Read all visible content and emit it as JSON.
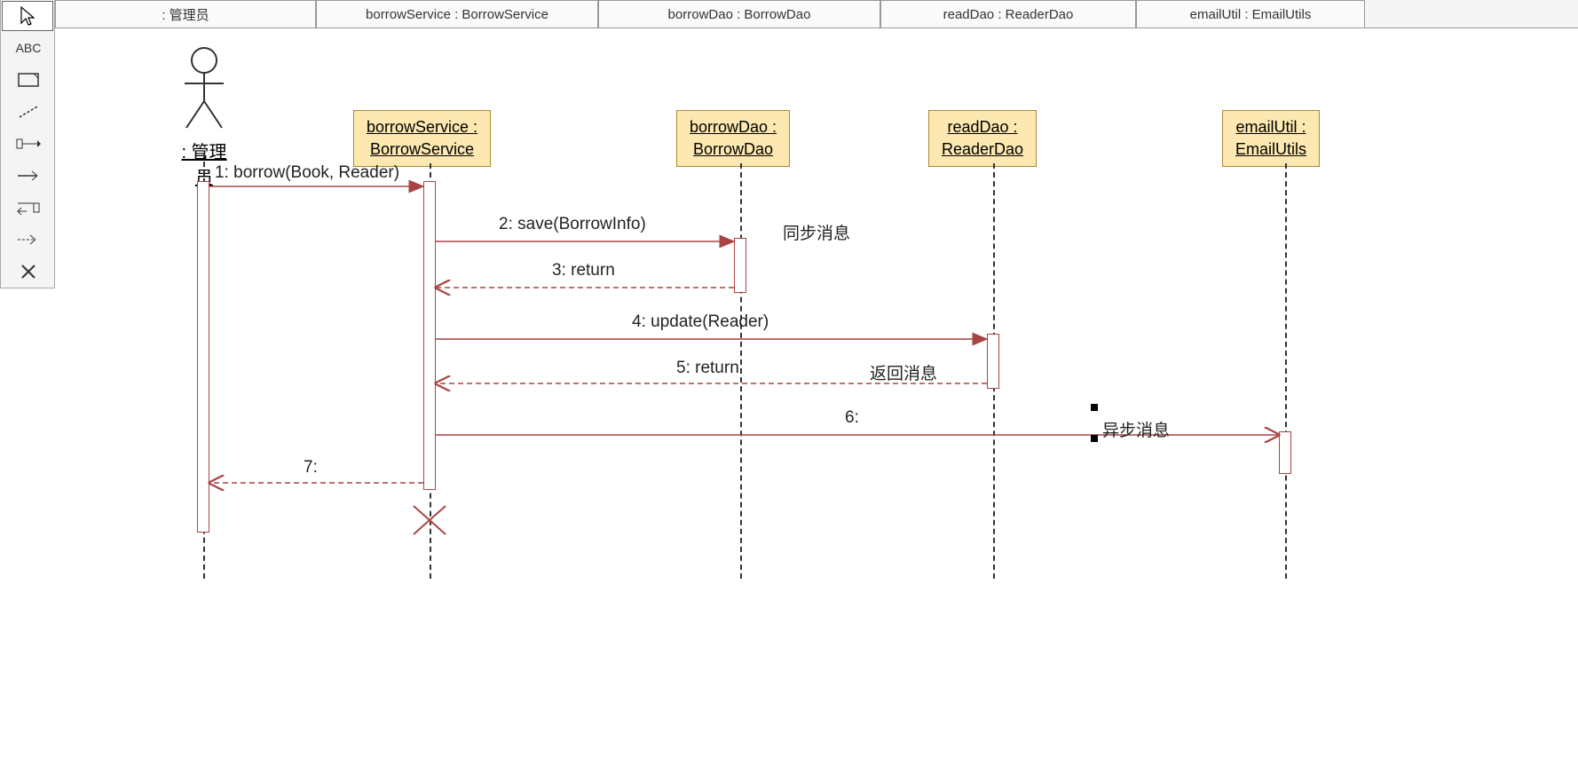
{
  "header": {
    "tabs": [
      {
        "label": ": 管理员"
      },
      {
        "label": "borrowService : BorrowService"
      },
      {
        "label": "borrowDao : BorrowDao"
      },
      {
        "label": "readDao : ReaderDao"
      },
      {
        "label": "emailUtil : EmailUtils"
      }
    ]
  },
  "toolbox": {
    "pointer": "↖",
    "text": "ABC",
    "note": "▭",
    "line": "╱",
    "sync": "⟸",
    "async": "→",
    "return": "↩",
    "create": "⤳",
    "delete": "✕"
  },
  "participants": {
    "actor": {
      "label": ": 管理员"
    },
    "borrowService": {
      "name": "borrowService :",
      "type": "BorrowService"
    },
    "borrowDao": {
      "name": "borrowDao :",
      "type": "BorrowDao"
    },
    "readDao": {
      "name": "readDao :",
      "type": "ReaderDao"
    },
    "emailUtil": {
      "name": "emailUtil :",
      "type": "EmailUtils"
    }
  },
  "messages": {
    "m1": "1: borrow(Book, Reader)",
    "m2": "2: save(BorrowInfo)",
    "m3": "3: return",
    "m4": "4: update(Reader)",
    "m5": "5: return",
    "m6": "6:",
    "m7": "7:"
  },
  "notes": {
    "sync": "同步消息",
    "ret": "返回消息",
    "async": "异步消息"
  }
}
